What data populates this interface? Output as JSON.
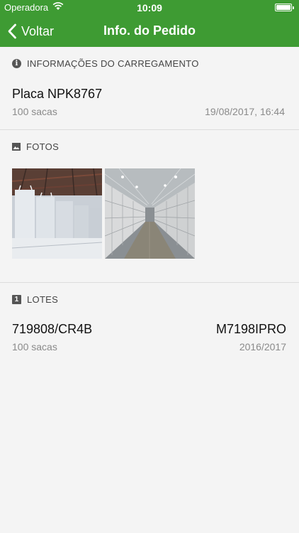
{
  "status_bar": {
    "carrier": "Operadora",
    "time": "10:09"
  },
  "nav": {
    "back_label": "Voltar",
    "title": "Info. do Pedido"
  },
  "loading_section": {
    "header": "INFORMAÇÕES DO CARREGAMENTO",
    "plate": "Placa NPK8767",
    "bags": "100 sacas",
    "datetime": "19/08/2017, 16:44"
  },
  "photos_section": {
    "header": "FOTOS",
    "photos": [
      "warehouse-bags-photo",
      "warehouse-aisle-photo"
    ]
  },
  "lots_section": {
    "header": "LOTES",
    "badge": "1",
    "lots": [
      {
        "code": "719808/CR4B",
        "variety": "M7198IPRO",
        "bags": "100 sacas",
        "season": "2016/2017"
      }
    ]
  },
  "colors": {
    "accent": "#3e9b33",
    "background": "#f4f4f4"
  }
}
